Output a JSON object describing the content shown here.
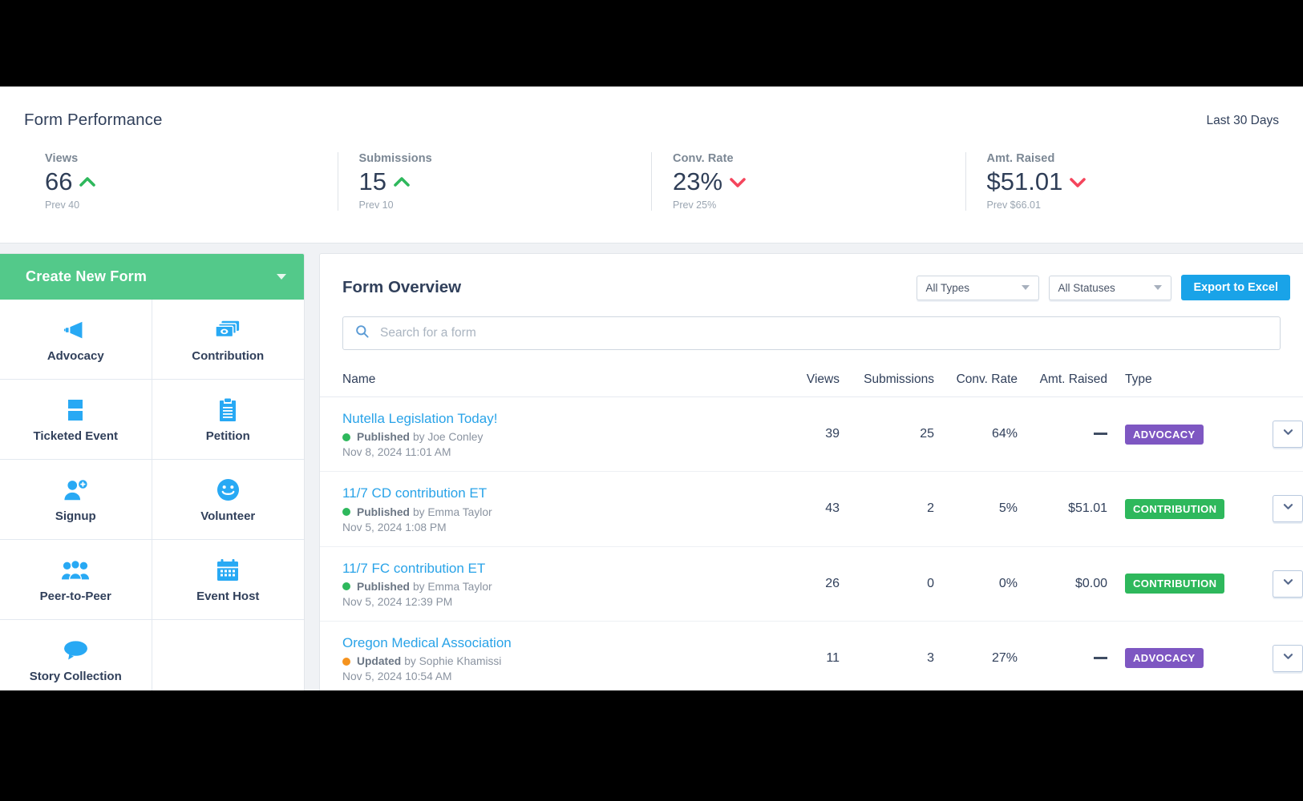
{
  "performance": {
    "title": "Form Performance",
    "range_label": "Last 30 Days",
    "stats": [
      {
        "label": "Views",
        "value": "66",
        "trend": "up",
        "prev": "Prev 40"
      },
      {
        "label": "Submissions",
        "value": "15",
        "trend": "up",
        "prev": "Prev 10"
      },
      {
        "label": "Conv. Rate",
        "value": "23%",
        "trend": "down",
        "prev": "Prev 25%"
      },
      {
        "label": "Amt. Raised",
        "value": "$51.01",
        "trend": "down",
        "prev": "Prev $66.01"
      }
    ],
    "colors": {
      "up": "#2eb85c",
      "down": "#f4455c"
    }
  },
  "sidebar": {
    "create_button_label": "Create New Form",
    "create_button_color": "#53c98a",
    "form_types": [
      {
        "label": "Advocacy",
        "icon": "megaphone-icon"
      },
      {
        "label": "Contribution",
        "icon": "money-icon"
      },
      {
        "label": "Ticketed Event",
        "icon": "ticket-icon"
      },
      {
        "label": "Petition",
        "icon": "clipboard-icon"
      },
      {
        "label": "Signup",
        "icon": "user-plus-icon"
      },
      {
        "label": "Volunteer",
        "icon": "smiley-icon"
      },
      {
        "label": "Peer-to-Peer",
        "icon": "people-icon"
      },
      {
        "label": "Event Host",
        "icon": "calendar-icon"
      },
      {
        "label": "Story Collection",
        "icon": "speech-bubble-icon"
      }
    ],
    "icon_color": "#28a9f4"
  },
  "overview": {
    "title": "Form Overview",
    "type_filter": {
      "value": "All Types",
      "icon": "chevron-down-icon"
    },
    "status_filter": {
      "value": "All Statuses",
      "icon": "chevron-down-icon"
    },
    "export_label": "Export to Excel",
    "export_color": "#19a3e8",
    "search": {
      "value": "",
      "placeholder": "Search for a form",
      "icon": "search-icon"
    },
    "columns": [
      "Name",
      "Views",
      "Submissions",
      "Conv. Rate",
      "Amt. Raised",
      "Type"
    ],
    "rows": [
      {
        "name": "Nutella Legislation Today!",
        "status": "Published",
        "status_color": "#2eb85c",
        "author": "by Joe Conley",
        "date": "Nov 8, 2024 11:01 AM",
        "views": "39",
        "submissions": "25",
        "conv_rate": "64%",
        "amt_raised": "",
        "amt_is_dash": true,
        "type": "ADVOCACY",
        "type_class": "advocacy"
      },
      {
        "name": "11/7 CD contribution ET",
        "status": "Published",
        "status_color": "#2eb85c",
        "author": "by Emma Taylor",
        "date": "Nov 5, 2024 1:08 PM",
        "views": "43",
        "submissions": "2",
        "conv_rate": "5%",
        "amt_raised": "$51.01",
        "amt_is_dash": false,
        "type": "CONTRIBUTION",
        "type_class": "contribution"
      },
      {
        "name": "11/7 FC contribution ET",
        "status": "Published",
        "status_color": "#2eb85c",
        "author": "by Emma Taylor",
        "date": "Nov 5, 2024 12:39 PM",
        "views": "26",
        "submissions": "0",
        "conv_rate": "0%",
        "amt_raised": "$0.00",
        "amt_is_dash": false,
        "type": "CONTRIBUTION",
        "type_class": "contribution"
      },
      {
        "name": "Oregon Medical Association",
        "status": "Updated",
        "status_color": "#f5931e",
        "author": "by Sophie Khamissi",
        "date": "Nov 5, 2024 10:54 AM",
        "views": "11",
        "submissions": "3",
        "conv_rate": "27%",
        "amt_raised": "",
        "amt_is_dash": true,
        "type": "ADVOCACY",
        "type_class": "advocacy"
      }
    ],
    "row_menu_icon": "chevron-down-icon"
  }
}
